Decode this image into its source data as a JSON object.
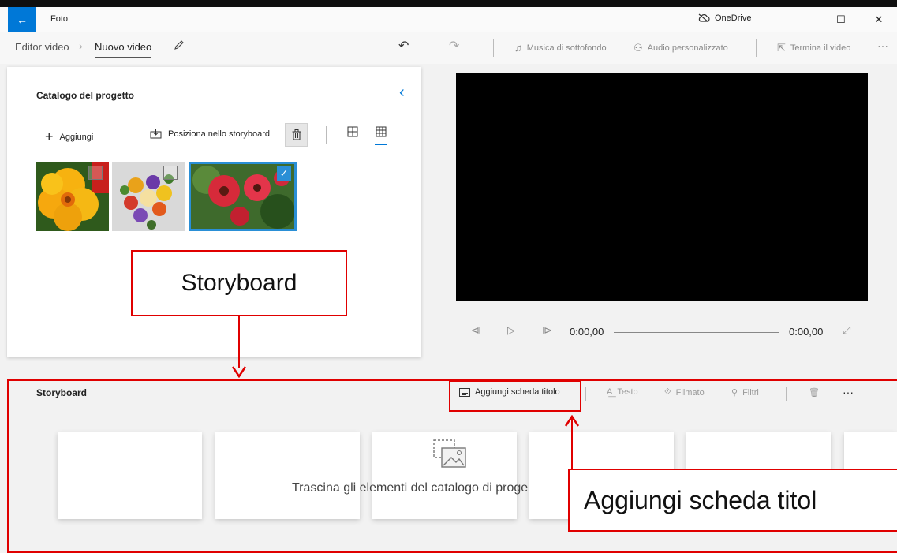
{
  "window": {
    "app_title": "Foto",
    "onedrive_label": "OneDrive",
    "back_glyph": "←",
    "minimize_glyph": "—",
    "maximize_glyph": "☐",
    "close_glyph": "✕"
  },
  "breadcrumb": {
    "parent": "Editor video",
    "separator": "›",
    "current": "Nuovo video"
  },
  "toolbar": {
    "undo_glyph": "↶",
    "redo_glyph": "↷",
    "background_music": "Musica di sottofondo",
    "custom_audio": "Audio personalizzato",
    "finish_video": "Termina il video",
    "more_glyph": "···"
  },
  "catalog": {
    "title": "Catalogo del progetto",
    "add_label": "Aggiungi",
    "place_in_storyboard": "Posiziona nello storyboard",
    "collapse_glyph": "‹",
    "thumbnails": [
      {
        "name": "yellow-flower",
        "selected": false
      },
      {
        "name": "bouquet",
        "selected": false
      },
      {
        "name": "red-gerbera",
        "selected": true
      }
    ]
  },
  "player": {
    "current_time": "0:00,00",
    "total_time": "0:00,00"
  },
  "storyboard": {
    "title": "Storyboard",
    "add_title_card": "Aggiungi scheda titolo",
    "text": "Testo",
    "motion": "Filmato",
    "filters": "Filtri",
    "more_glyph": "···",
    "drop_hint": "Trascina gli elementi del catalogo di proge"
  },
  "annotations": {
    "storyboard_callout": "Storyboard",
    "title_card_callout": "Aggiungi scheda titol",
    "color": "#e00000"
  },
  "colors": {
    "accent": "#0078d7",
    "selection_check": "#2a8fd6"
  }
}
